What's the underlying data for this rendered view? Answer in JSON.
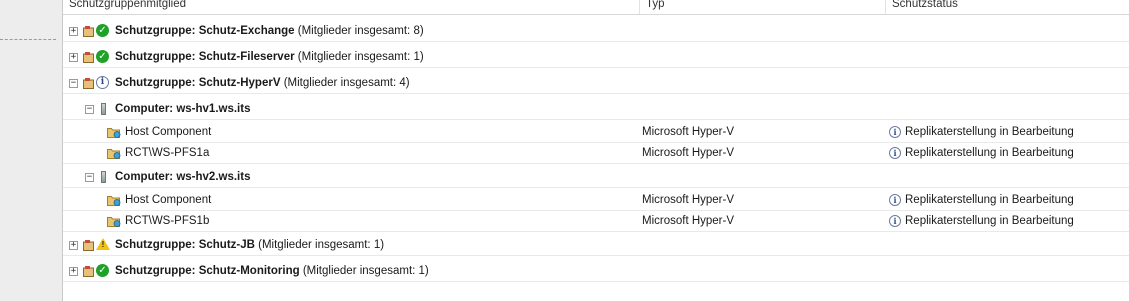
{
  "columns": {
    "member": "Schutzgruppenmitglied",
    "type": "Typ",
    "status": "Schutzstatus"
  },
  "groups": [
    {
      "prefix": "Schutzgruppe: ",
      "name": "Schutz-Exchange",
      "count": "(Mitglieder insgesamt: 8)",
      "expander": "+",
      "state": "ok"
    },
    {
      "prefix": "Schutzgruppe: ",
      "name": "Schutz-Fileserver",
      "count": "(Mitglieder insgesamt: 1)",
      "expander": "+",
      "state": "ok"
    },
    {
      "prefix": "Schutzgruppe: ",
      "name": "Schutz-HyperV",
      "count": "(Mitglieder insgesamt: 4)",
      "expander": "−",
      "state": "info"
    },
    {
      "prefix": "Schutzgruppe: ",
      "name": "Schutz-JB",
      "count": "(Mitglieder insgesamt: 1)",
      "expander": "+",
      "state": "warning"
    },
    {
      "prefix": "Schutzgruppe: ",
      "name": "Schutz-Monitoring",
      "count": "(Mitglieder insgesamt: 1)",
      "expander": "+",
      "state": "ok"
    }
  ],
  "computers": [
    {
      "label": "Computer:",
      "name": "ws-hv1.ws.its",
      "expander": "−",
      "members": [
        {
          "name": "Host Component",
          "type": "Microsoft Hyper-V",
          "status": "Replikaterstellung in Bearbeitung"
        },
        {
          "name": "RCT\\WS-PFS1a",
          "type": "Microsoft Hyper-V",
          "status": "Replikaterstellung in Bearbeitung"
        }
      ]
    },
    {
      "label": "Computer:",
      "name": "ws-hv2.ws.its",
      "expander": "−",
      "members": [
        {
          "name": "Host Component",
          "type": "Microsoft Hyper-V",
          "status": "Replikaterstellung in Bearbeitung"
        },
        {
          "name": "RCT\\WS-PFS1b",
          "type": "Microsoft Hyper-V",
          "status": "Replikaterstellung in Bearbeitung"
        }
      ]
    }
  ],
  "colors": {
    "ok": "#1fa12a",
    "warning": "#f3c20e",
    "info": "#2c4b8c"
  },
  "icons": {
    "protection_group": "protection-group-icon",
    "computer": "computer-icon",
    "datasource": "datasource-icon",
    "ok": "check-icon",
    "info": "info-icon",
    "warning": "warning-icon"
  }
}
